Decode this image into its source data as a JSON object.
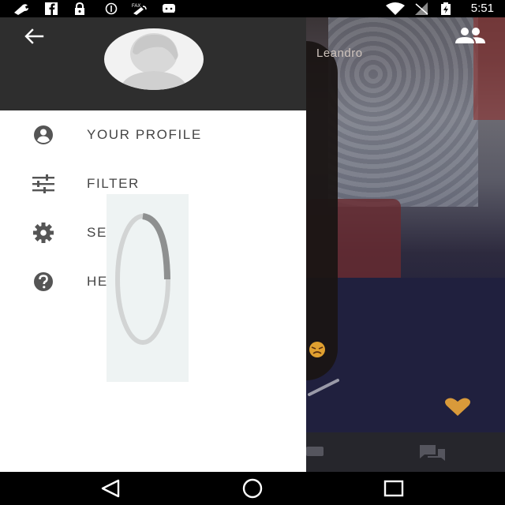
{
  "status_bar": {
    "time": "5:51",
    "left_icons": [
      "wrench-icon",
      "facebook-icon",
      "lock-icon",
      "data-saver-icon",
      "fax-icon",
      "android-icon"
    ],
    "right_icons": [
      "wifi-icon",
      "no-signal-icon",
      "battery-charging-icon"
    ]
  },
  "drawer": {
    "items": [
      {
        "label": "YOUR PROFILE",
        "icon": "account-circle-icon"
      },
      {
        "label": "FILTER",
        "icon": "tune-icon"
      },
      {
        "label": "SE",
        "icon": "settings-icon"
      },
      {
        "label": "HE",
        "icon": "help-icon"
      }
    ]
  },
  "video": {
    "remote_name": "Leandro"
  },
  "loading": {
    "spinner_icon": "loading-spinner-icon"
  },
  "colors": {
    "drawer_header": "#2e2e2e",
    "drawer_bg": "#ffffff",
    "icon_gray": "#555555",
    "heart": "#d99a3a",
    "angry_emoji": "#e0a030"
  },
  "nav_bar": {
    "buttons": [
      "back-triangle-icon",
      "home-circle-icon",
      "recents-square-icon"
    ]
  }
}
